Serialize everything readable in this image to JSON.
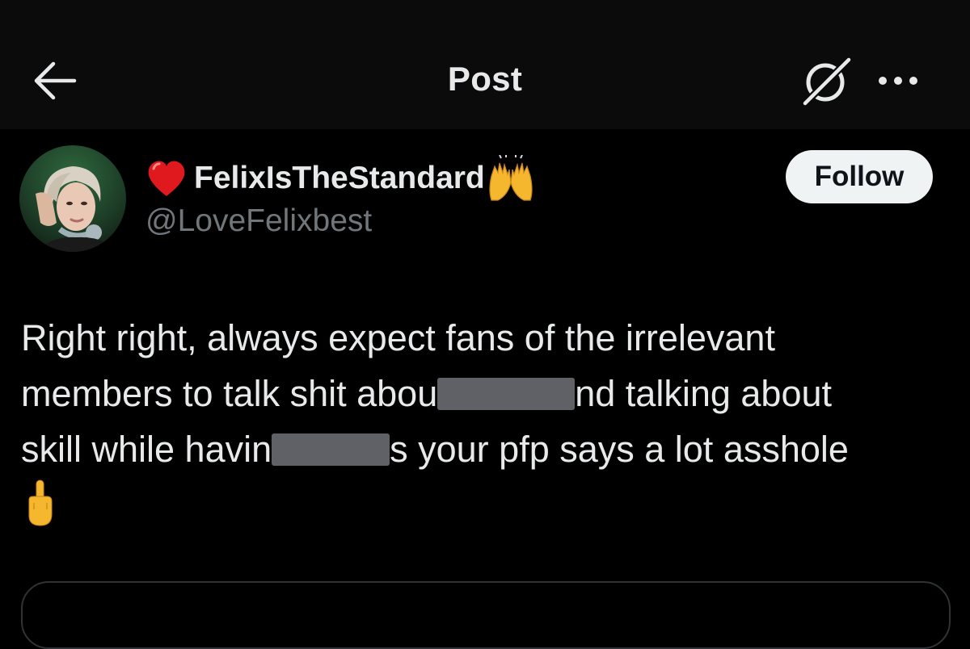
{
  "header": {
    "title": "Post",
    "back_icon": "arrow-left-icon",
    "grok_icon": "grok-slash-icon",
    "more_icon": "ellipsis-icon"
  },
  "author": {
    "display_name": "FelixIsTheStandard",
    "handle": "@LoveFelixbest",
    "prefix_emoji": "red-heart-icon",
    "suffix_emoji": "raising-hands-icon",
    "follow_label": "Follow"
  },
  "post": {
    "lines": [
      {
        "before": "Right right, always expect fans of the irrelevant"
      },
      {
        "before": "members to talk shit abou",
        "after": "nd talking about"
      },
      {
        "before": "skill while havin",
        "after": "s your pfp says a lot asshole"
      }
    ],
    "trailing_emoji": "middle-finger-icon"
  },
  "colors": {
    "background": "#000000",
    "header_background": "#0b0b0b",
    "text_primary": "#e7e9ea",
    "text_secondary": "#71767b",
    "follow_button_bg": "#eff3f4",
    "redaction": "#5f6166",
    "card_border": "#2f3336"
  }
}
